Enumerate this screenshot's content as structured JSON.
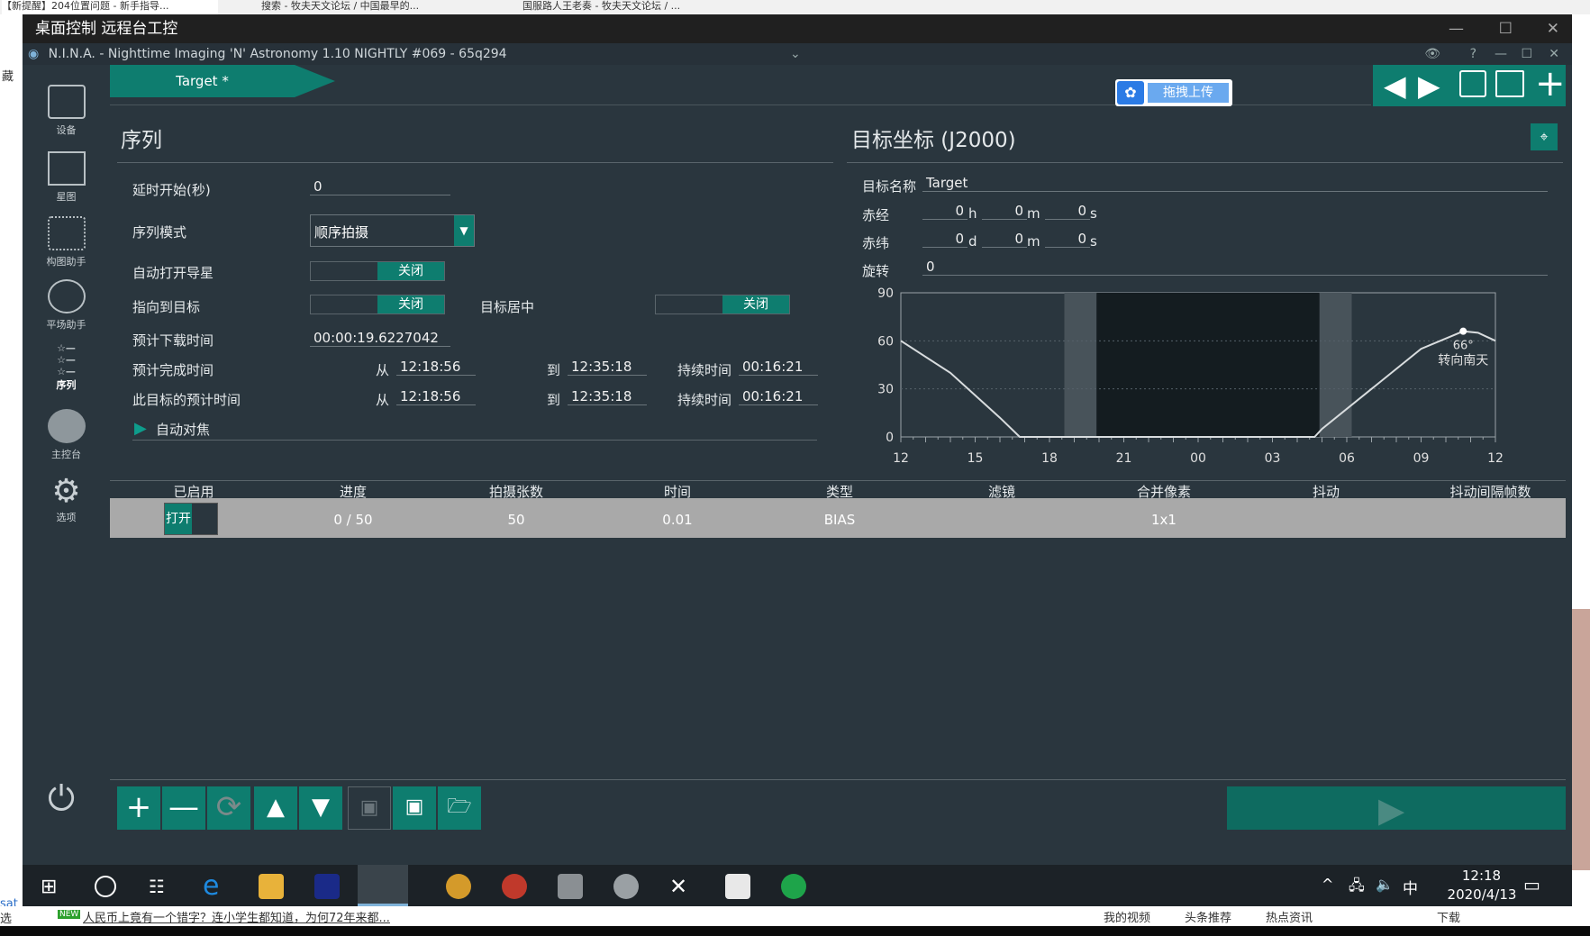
{
  "browser": {
    "tabs": [
      "【新提醒】204位置问题 - 新手指导...",
      "搜索 - 牧夫天文论坛 / 中国最早的...",
      "国服路人王老奏 - 牧夫天文论坛 / ..."
    ],
    "bottom_news": "人民币上竟有一个错字？连小学生都知道，为何72年来都...",
    "bottom_links": [
      "我的视频",
      "头条推荐",
      "热点资讯",
      "下载"
    ],
    "left_text": [
      "藏",
      "sat",
      "选"
    ]
  },
  "remote": {
    "title": "桌面控制 远程台工控"
  },
  "nina": {
    "title": "N.I.N.A. - Nighttime Imaging 'N' Astronomy 1.10 NIGHTLY #069  -  65q294",
    "target_tab": "Target *",
    "upload_label": "拖拽上传",
    "sidebar": [
      {
        "label": "设备",
        "icon": "equipment-icon"
      },
      {
        "label": "星图",
        "icon": "skymap-icon"
      },
      {
        "label": "构图助手",
        "icon": "framing-icon"
      },
      {
        "label": "平场助手",
        "icon": "flat-wizard-icon"
      },
      {
        "label": "序列",
        "icon": "sequence-icon"
      },
      {
        "label": "主控台",
        "icon": "imaging-icon"
      },
      {
        "label": "选项",
        "icon": "gear-icon"
      }
    ],
    "sequence": {
      "title": "序列",
      "delay_label": "延时开始(秒)",
      "delay_value": "0",
      "mode_label": "序列模式",
      "mode_value": "顺序拍摄",
      "autoguide_label": "自动打开导星",
      "autoguide_state": "关闭",
      "slew_label": "指向到目标",
      "slew_state": "关闭",
      "center_label": "目标居中",
      "center_state": "关闭",
      "download_label": "预计下载时间",
      "download_value": "00:00:19.6227042",
      "finish_label": "预计完成时间",
      "target_time_label": "此目标的预计时间",
      "from": "从",
      "to": "到",
      "duration": "持续时间",
      "finish_from": "12:18:56",
      "finish_to": "12:35:18",
      "finish_duration": "00:16:21",
      "target_from": "12:18:56",
      "target_to": "12:35:18",
      "target_duration": "00:16:21",
      "autofocus_label": "自动对焦"
    },
    "target": {
      "title": "目标坐标 (J2000)",
      "name_label": "目标名称",
      "name_value": "Target",
      "ra_label": "赤经",
      "ra_h": "0",
      "ra_m": "0",
      "ra_s": "0",
      "dec_label": "赤纬",
      "dec_d": "0",
      "dec_m": "0",
      "dec_s": "0",
      "rotation_label": "旋转",
      "rotation_value": "0",
      "unit_h": "h",
      "unit_m": "m",
      "unit_s": "s",
      "unit_d": "d"
    },
    "table": {
      "headers": [
        "已启用",
        "进度",
        "拍摄张数",
        "时间",
        "类型",
        "滤镜",
        "合并像素",
        "抖动",
        "抖动间隔帧数"
      ],
      "row": {
        "enabled": "打开",
        "progress": "0 / 50",
        "count": "50",
        "time": "0.01",
        "type": "BIAS",
        "filter": "",
        "binning": "1x1",
        "dither": "",
        "dither_every": ""
      }
    }
  },
  "chart_data": {
    "type": "line",
    "title": "",
    "x_ticks": [
      "12",
      "15",
      "18",
      "21",
      "00",
      "03",
      "06",
      "09",
      "12"
    ],
    "y_ticks": [
      0,
      30,
      60,
      90
    ],
    "ylim": [
      0,
      90
    ],
    "series": [
      {
        "x_hours": [
          12,
          14,
          16,
          16.8,
          16.9,
          28.7,
          29,
          31,
          33,
          34.7,
          35.3,
          36
        ],
        "y": [
          60,
          40,
          12,
          0,
          0,
          0,
          5,
          30,
          55,
          66,
          65,
          60
        ]
      }
    ],
    "annotation": {
      "label": "66°",
      "sub": "转向南天",
      "x_hour": 34.7,
      "y": 66
    },
    "night_bands": [
      {
        "from": 18.6,
        "to": 19.9,
        "shade": "twilight"
      },
      {
        "from": 19.9,
        "to": 28.9,
        "shade": "night"
      },
      {
        "from": 28.9,
        "to": 30.2,
        "shade": "twilight"
      }
    ]
  },
  "taskbar": {
    "time": "12:18",
    "date": "2020/4/13",
    "ime": "中",
    "icons": [
      "start-icon",
      "search-icon",
      "taskview-icon",
      "edge-icon",
      "explorer-icon",
      "app-icon",
      "nina-icon",
      "stellarium-icon",
      "app2-icon",
      "app3-icon",
      "app4-icon",
      "x-icon",
      "window-icon",
      "phd-icon"
    ]
  }
}
